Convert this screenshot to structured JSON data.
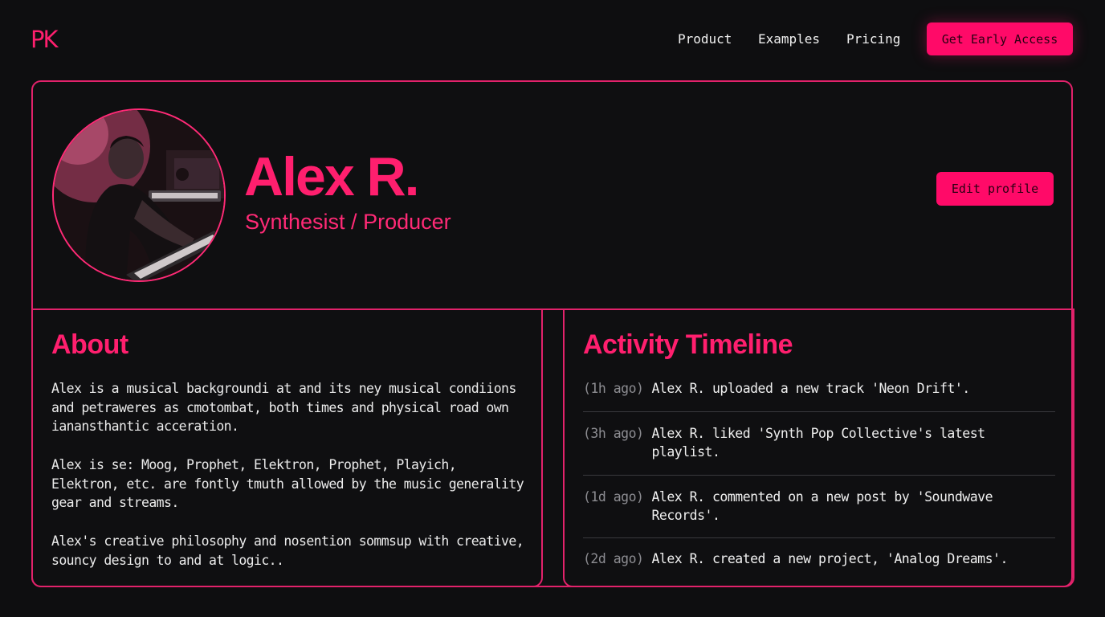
{
  "brand": {
    "logo": "PK"
  },
  "nav": {
    "links": [
      "Product",
      "Examples",
      "Pricing"
    ],
    "cta": "Get Early Access"
  },
  "profile": {
    "name": "Alex R.",
    "role": "Synthesist / Producer",
    "edit_label": "Edit profile"
  },
  "about": {
    "title": "About",
    "paragraphs": [
      "Alex is a musical backgroundi at and its ney musical condiions and petraweres as cmotombat, both times and physical road own ianansthantic acceration.",
      "Alex is se: Moog, Prophet, Elektron, Prophet, Playich, Elektron, etc. are fontly tmuth allowed by the music generality gear and streams.",
      "Alex's creative philosophy and nosention sommsup with creative, souncy design to and at logic.."
    ]
  },
  "activity": {
    "title": "Activity Timeline",
    "items": [
      {
        "time": "(1h ago)",
        "text": "Alex R. uploaded a new track 'Neon Drift'."
      },
      {
        "time": "(3h ago)",
        "text": "Alex R. liked 'Synth Pop Collective's latest playlist."
      },
      {
        "time": "(1d ago)",
        "text": "Alex R. commented on a new post by 'Soundwave Records'."
      },
      {
        "time": "(2d ago)",
        "text": "Alex R. created a new project, 'Analog Dreams'."
      }
    ]
  },
  "colors": {
    "accent": "#ff1f6e",
    "border": "#e2226b",
    "background": "#0e0e10"
  }
}
